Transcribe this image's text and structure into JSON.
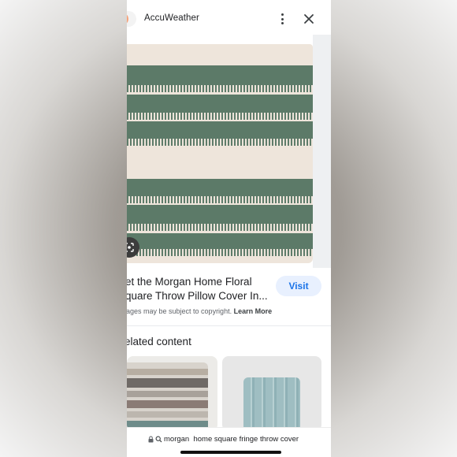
{
  "header": {
    "site_name": "AccuWeather",
    "icons": {
      "site": "accuweather-sun-icon",
      "more": "more-vert-icon",
      "close": "close-icon"
    }
  },
  "result": {
    "title_line1": "et the Morgan Home Floral",
    "title_line2": "quare Throw Pillow Cover In...",
    "visit_label": "Visit",
    "copyright_text": "ages may be subject to copyright.",
    "learn_more_label": "Learn More"
  },
  "related": {
    "title": "elated content"
  },
  "url_bar": {
    "query": "morgan  home square fringe throw cover",
    "icons": [
      "lock-icon",
      "search-icon"
    ]
  },
  "colors": {
    "accent": "#1a73e8",
    "visit_bg": "#e8f0fe",
    "pillow_green": "#5c7a68",
    "pillow_cream": "#eee5db"
  }
}
